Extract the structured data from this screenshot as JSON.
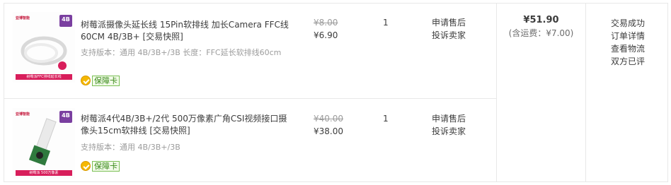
{
  "items": [
    {
      "title": "树莓派摄像头延长线 15Pin软排线 加长Camera FFC线60CM 4B/3B+ [交易快照]",
      "spec": "支持版本：通用 4B/3B+/3B 长度：FFC延长软排线60cm",
      "badge": "保障卡",
      "thumb_brand": "亚博智能",
      "thumb_version": "4B",
      "thumb_caption": "树莓派FFC排线延长线",
      "orig_price": "¥8.00",
      "price": "¥6.90",
      "qty": "1",
      "op_after_sale": "申请售后",
      "op_complain": "投诉卖家"
    },
    {
      "title": "树莓派4代4B/3B+/2代 500万像素广角CSI视频接口摄像头15cm软排线 [交易快照]",
      "spec": "支持版本：通用 4B/3B+/3B",
      "badge": "保障卡",
      "thumb_brand": "亚博智能",
      "thumb_version": "4B",
      "thumb_caption": "树莓派 500万像素",
      "orig_price": "¥40.00",
      "price": "¥38.00",
      "qty": "1",
      "op_after_sale": "申请售后",
      "op_complain": "投诉卖家"
    }
  ],
  "total": {
    "amount": "¥51.90",
    "shipping": "(含运费：¥7.00)"
  },
  "status": {
    "state": "交易成功",
    "detail": "订单详情",
    "logistics": "查看物流",
    "review": "双方已评"
  },
  "colors": {
    "border": "#e8e8e8",
    "brand_red": "#d81e5b",
    "badge_green": "#3a8a1a"
  }
}
